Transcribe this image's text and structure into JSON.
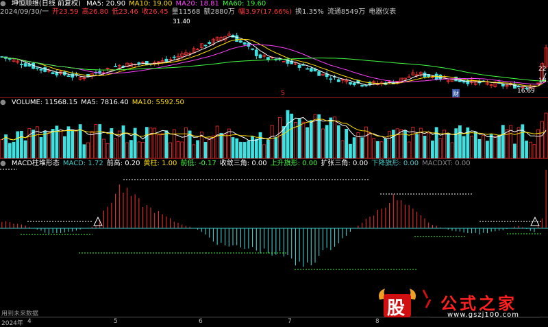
{
  "title_row": {
    "name": "坤恒顺维(日线 前复权)",
    "indicators": [
      {
        "label": "MA5: 20.90",
        "color": "#ffffff"
      },
      {
        "label": "MA10: 19.00",
        "color": "#ffe000"
      },
      {
        "label": "MA20: 18.81",
        "color": "#ff40ff"
      },
      {
        "label": "MA60: 19.60",
        "color": "#40ff40"
      }
    ]
  },
  "quote_row": {
    "items": [
      {
        "label": "2024/09/30/一",
        "color": "#c8c8c8"
      },
      {
        "label": "开23.59",
        "color": "#ff3a3a"
      },
      {
        "label": "高26.80",
        "color": "#ff3a3a"
      },
      {
        "label": "低23.46",
        "color": "#ff3a3a"
      },
      {
        "label": "收26.45",
        "color": "#ff3a3a"
      },
      {
        "label": "量11568",
        "color": "#c8c8c8"
      },
      {
        "label": "额2880万",
        "color": "#c8c8c8"
      },
      {
        "label": "幅3.97(17.66%)",
        "color": "#ff3a3a"
      },
      {
        "label": "换1.35%",
        "color": "#c8c8c8"
      },
      {
        "label": "流通8549万",
        "color": "#c8c8c8"
      },
      {
        "label": "电器仪表",
        "color": "#c8c8c8"
      }
    ]
  },
  "price_panel": {
    "high_label": "31.40",
    "low_label": "16.69",
    "right_labels": [
      "22",
      "18.5"
    ],
    "marker_cai": "财",
    "marker_s": "S"
  },
  "volume_header": {
    "items": [
      {
        "label": "VOLUME: 11568.15",
        "color": "#ffffff"
      },
      {
        "label": "MA5: 7816.40",
        "color": "#ffffff"
      },
      {
        "label": "MA10: 5592.50",
        "color": "#ffe000"
      }
    ]
  },
  "macd_header": {
    "items": [
      {
        "label": "MACD柱堆形态",
        "color": "#ffffff"
      },
      {
        "label": "MACD: 1.72",
        "color": "#40c8c8"
      },
      {
        "label": "前高: 0.20",
        "color": "#ffffff"
      },
      {
        "label": "黄柱: 1.00",
        "color": "#ffe000"
      },
      {
        "label": "前低: -0.17",
        "color": "#40ff40"
      },
      {
        "label": "收敛三角: 0.00",
        "color": "#ffffff"
      },
      {
        "label": "上升旗形: 0.00",
        "color": "#40ff40"
      },
      {
        "label": "扩张三角: 0.00",
        "color": "#ffffff"
      },
      {
        "label": "下降旗形: 0.00",
        "color": "#40c8c8"
      },
      {
        "label": "MACDXT: 0.00",
        "color": "#888888"
      }
    ]
  },
  "bottom_bar": {
    "future_text": "用到未来数据",
    "axis_labels": [
      "2024年",
      "4",
      "5",
      "6",
      "7",
      "8"
    ]
  },
  "watermark": {
    "badge": "股",
    "title": "公式之家",
    "url": "www.gszj100.com"
  },
  "colors": {
    "up": "#ff3030",
    "down": "#40e0e0",
    "bg": "#000000",
    "grid": "#7a1616"
  }
}
